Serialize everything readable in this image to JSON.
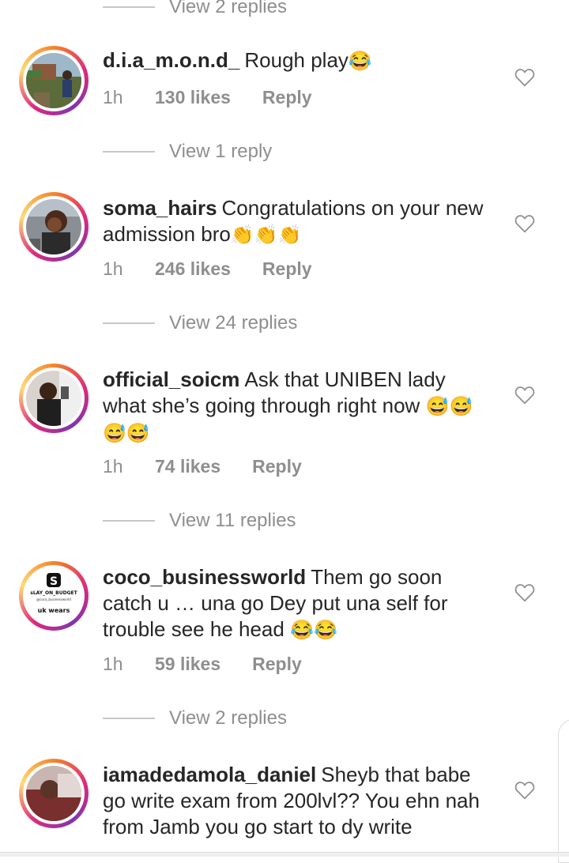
{
  "threads": [
    {
      "view_replies_above": "View 2 replies",
      "username": "d.i.a_m.o.n.d_",
      "text": "Rough play",
      "emoji": "😂",
      "time": "1h",
      "likes": "130 likes",
      "reply": "Reply",
      "view_replies_below": "View 1 reply"
    },
    {
      "username": "soma_hairs",
      "text": "Congratulations on your new admission bro",
      "emoji": "👏👏👏",
      "time": "1h",
      "likes": "246 likes",
      "reply": "Reply",
      "view_replies_below": "View 24 replies"
    },
    {
      "username": "official_soicm",
      "text": "Ask that UNIBEN lady what she’s going through right now",
      "emoji": "😅😅😅😅",
      "time": "1h",
      "likes": "74 likes",
      "reply": "Reply",
      "view_replies_below": "View 11 replies"
    },
    {
      "username": "coco_businessworld",
      "text": "Them go soon catch u … una go Dey put una self for trouble see he head",
      "emoji": "😂😂",
      "time": "1h",
      "likes": "59 likes",
      "reply": "Reply",
      "view_replies_below": "View 2 replies",
      "avatar_text": [
        "sLAY_ON_BUDGET",
        "@coco_businessworld",
        "uk wears"
      ]
    },
    {
      "username": "iamadedamola_daniel",
      "text": "Sheyb that babe go write exam from 200lvl?? You ehn nah from Jamb you go start to dy write",
      "emoji": ""
    }
  ],
  "icons": {
    "like": "heart-outline-icon"
  },
  "colors": {
    "muted": "#8e8e8e",
    "text": "#262626",
    "divider": "#c7c7c7"
  }
}
